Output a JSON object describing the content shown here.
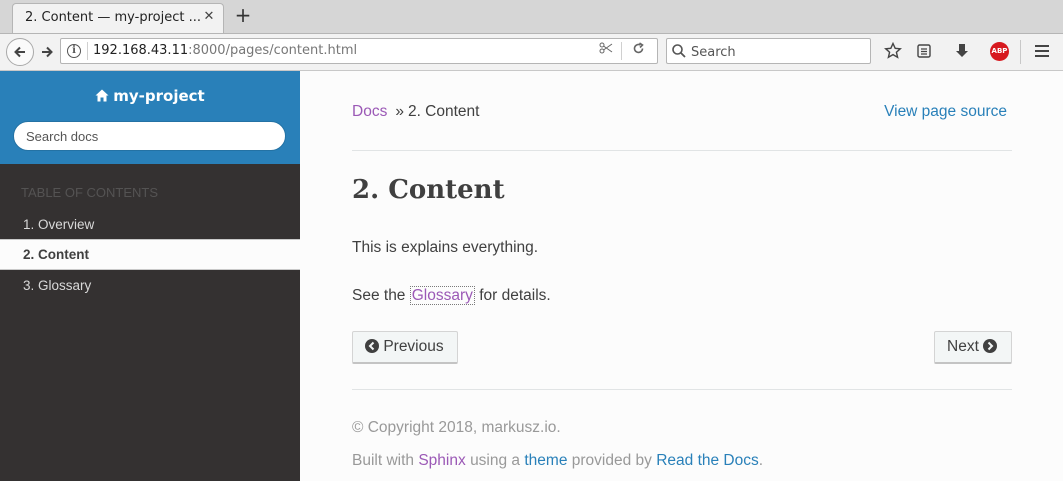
{
  "browser": {
    "tab_title": "2. Content — my-project ...",
    "tab_close": "✕",
    "new_tab": "+",
    "url_host": "192.168.43.11",
    "url_rest": ":8000/pages/content.html",
    "search_placeholder": "Search",
    "abp_label": "ABP"
  },
  "sidebar": {
    "project_name": "my-project",
    "search_placeholder": "Search docs",
    "toc_caption": "Table of Contents",
    "items": [
      {
        "label": "1. Overview",
        "current": false
      },
      {
        "label": "2. Content",
        "current": true
      },
      {
        "label": "3. Glossary",
        "current": false
      }
    ]
  },
  "content": {
    "breadcrumb_root": "Docs",
    "breadcrumb_sep": "»",
    "breadcrumb_current": "2. Content",
    "view_source": "View page source",
    "title": "2. Content",
    "para1": "This is explains everything.",
    "para2_before": "See the",
    "para2_link": "Glossary",
    "para2_after": "for details.",
    "prev_label": "Previous",
    "next_label": "Next",
    "copyright": "© Copyright 2018, markusz.io.",
    "built_prefix": "Built with",
    "built_sphinx": "Sphinx",
    "built_mid": "using a",
    "built_theme": "theme",
    "built_mid2": "provided by",
    "built_rtd": "Read the Docs",
    "built_end": "."
  },
  "colors": {
    "sidebar_top": "#2980b9",
    "sidebar_bg": "#343131",
    "link_purple": "#9b59b6",
    "link_blue": "#2980b9"
  }
}
